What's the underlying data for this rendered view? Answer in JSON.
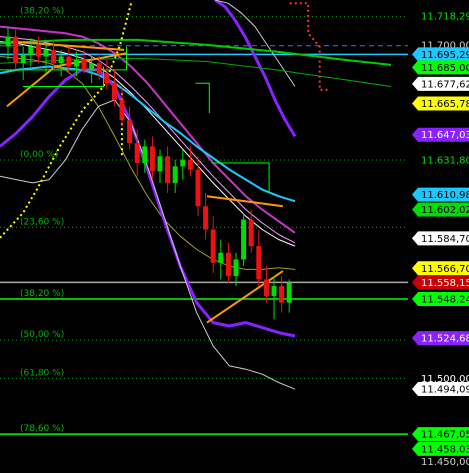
{
  "chart_data": {
    "type": "candlestick",
    "ylim": [
      11.446,
      11.728
    ],
    "grid": false,
    "fib_levels": [
      {
        "label": "(38,20 %)",
        "price": 11.718,
        "color": "#00a000",
        "style": "dotted"
      },
      {
        "label": "(0,00 %)",
        "price": 11.6318,
        "color": "#00a000",
        "style": "dotted"
      },
      {
        "label": "(23,60 %)",
        "price": 11.5913,
        "color": "#00a000",
        "style": "dotted"
      },
      {
        "label": "(38,20 %)",
        "price": 11.5482,
        "color": "#00ff00",
        "style": "solid"
      },
      {
        "label": "(50,00 %)",
        "price": 11.5235,
        "color": "#00a000",
        "style": "dotted"
      },
      {
        "label": "(61,80 %)",
        "price": 11.5005,
        "color": "#00a000",
        "style": "dotted"
      },
      {
        "label": "(78,60 %)",
        "price": 11.467,
        "color": "#00ff00",
        "style": "solid"
      }
    ],
    "horizontal_lines": [
      {
        "price": 11.6953,
        "color": "#1ec8ff",
        "style": "solid"
      },
      {
        "price": 11.7005,
        "color": "#4a6bff",
        "style": "dashed"
      },
      {
        "price": 11.5582,
        "color": "#aaaaaa",
        "style": "solid"
      }
    ],
    "price_labels": [
      {
        "text": "11.718,29",
        "price": 11.7183,
        "bg": "#000000",
        "fg": "#00e000"
      },
      {
        "text": "11.700,00",
        "price": 11.701,
        "bg": "#000000",
        "fg": "#cfcfcf"
      },
      {
        "text": "11.695,29",
        "price": 11.6953,
        "bg": "#1ec8ff",
        "fg": "#000000"
      },
      {
        "text": "11.685,00",
        "price": 11.6875,
        "bg": "#00ff00",
        "fg": "#000000"
      },
      {
        "text": "11.677,62",
        "price": 11.6776,
        "bg": "#ffffff",
        "fg": "#000000"
      },
      {
        "text": "11.665,78",
        "price": 11.6658,
        "bg": "#ffff00",
        "fg": "#000000"
      },
      {
        "text": "11.647,03",
        "price": 11.647,
        "bg": "#8a22ff",
        "fg": "#ffffff"
      },
      {
        "text": "11.631,80",
        "price": 11.6318,
        "bg": "#000000",
        "fg": "#00e000"
      },
      {
        "text": "11.610,98",
        "price": 11.611,
        "bg": "#1ec8ff",
        "fg": "#000000"
      },
      {
        "text": "11.602,02",
        "price": 11.602,
        "bg": "#00dd00",
        "fg": "#000000"
      },
      {
        "text": "11.584,70",
        "price": 11.5847,
        "bg": "#ffffff",
        "fg": "#000000"
      },
      {
        "text": "11.566,70",
        "price": 11.5667,
        "bg": "#ffff00",
        "fg": "#000000"
      },
      {
        "text": "11.558,15",
        "price": 11.5582,
        "bg": "#cc0000",
        "fg": "#ffffff"
      },
      {
        "text": "11.548,24",
        "price": 11.5482,
        "bg": "#00ff00",
        "fg": "#000000"
      },
      {
        "text": "11.524,68",
        "price": 11.5247,
        "bg": "#8a22ff",
        "fg": "#ffffff"
      },
      {
        "text": "11.500,00",
        "price": 11.5003,
        "bg": "#000000",
        "fg": "#ffffff"
      },
      {
        "text": "11.494,09",
        "price": 11.4941,
        "bg": "#ffffff",
        "fg": "#000000"
      },
      {
        "text": "11.467,05",
        "price": 11.467,
        "bg": "#00ff00",
        "fg": "#000000"
      },
      {
        "text": "11.458,03",
        "price": 11.4581,
        "bg": "#00ff00",
        "fg": "#000000"
      },
      {
        "text": "11.450,00",
        "price": 11.4505,
        "bg": "#000000",
        "fg": "#cfcfcf"
      }
    ],
    "candles": [
      [
        11.7,
        11.712,
        11.692,
        11.706
      ],
      [
        11.706,
        11.71,
        11.686,
        11.69
      ],
      [
        11.69,
        11.7,
        11.68,
        11.695
      ],
      [
        11.695,
        11.705,
        11.688,
        11.7
      ],
      [
        11.7,
        11.706,
        11.69,
        11.694
      ],
      [
        11.694,
        11.702,
        11.684,
        11.698
      ],
      [
        11.698,
        11.704,
        11.686,
        11.69
      ],
      [
        11.69,
        11.698,
        11.682,
        11.694
      ],
      [
        11.694,
        11.7,
        11.684,
        11.688
      ],
      [
        11.688,
        11.697,
        11.682,
        11.692
      ],
      [
        11.692,
        11.698,
        11.684,
        11.686
      ],
      [
        11.686,
        11.694,
        11.678,
        11.69
      ],
      [
        11.69,
        11.696,
        11.68,
        11.684
      ],
      [
        11.684,
        11.692,
        11.674,
        11.678
      ],
      [
        11.678,
        11.686,
        11.664,
        11.668
      ],
      [
        11.668,
        11.676,
        11.652,
        11.656
      ],
      [
        11.656,
        11.664,
        11.638,
        11.642
      ],
      [
        11.642,
        11.65,
        11.622,
        11.63
      ],
      [
        11.63,
        11.644,
        11.624,
        11.64
      ],
      [
        11.64,
        11.646,
        11.62,
        11.625
      ],
      [
        11.625,
        11.638,
        11.618,
        11.634
      ],
      [
        11.634,
        11.64,
        11.612,
        11.618
      ],
      [
        11.618,
        11.632,
        11.612,
        11.628
      ],
      [
        11.628,
        11.638,
        11.62,
        11.632
      ],
      [
        11.632,
        11.64,
        11.622,
        11.626
      ],
      [
        11.626,
        11.634,
        11.598,
        11.604
      ],
      [
        11.604,
        11.612,
        11.584,
        11.59
      ],
      [
        11.59,
        11.598,
        11.564,
        11.57
      ],
      [
        11.57,
        11.584,
        11.56,
        11.576
      ],
      [
        11.576,
        11.582,
        11.558,
        11.562
      ],
      [
        11.562,
        11.576,
        11.556,
        11.572
      ],
      [
        11.572,
        11.6,
        11.568,
        11.596
      ],
      [
        11.596,
        11.602,
        11.576,
        11.58
      ],
      [
        11.58,
        11.59,
        11.556,
        11.56
      ],
      [
        11.56,
        11.568,
        11.546,
        11.55
      ],
      [
        11.55,
        11.562,
        11.536,
        11.556
      ],
      [
        11.556,
        11.562,
        11.54,
        11.546
      ],
      [
        11.546,
        11.56,
        11.54,
        11.558
      ]
    ],
    "indicator_lines": [
      {
        "name": "",
        "color": "#cc33cc",
        "width": 2,
        "values": [
          11.712,
          11.711,
          11.71,
          11.709,
          11.708,
          11.706,
          11.702,
          11.696,
          11.688,
          11.678,
          11.666,
          11.654,
          11.642,
          11.63,
          11.62,
          11.61,
          11.602,
          11.595,
          11.588
        ]
      },
      {
        "name": "",
        "color": "#ff99ff",
        "width": 1,
        "values": [
          11.706,
          11.705,
          11.704,
          11.702,
          11.7,
          11.697,
          11.692,
          11.685,
          11.676,
          11.666,
          11.655,
          11.644,
          11.633,
          11.622,
          11.612,
          11.602,
          11.594,
          11.587,
          11.582
        ]
      },
      {
        "name": "",
        "color": "#ffffff",
        "width": 1,
        "values": [
          11.703,
          11.702,
          11.7,
          11.698,
          11.696,
          11.693,
          11.688,
          11.681,
          11.672,
          11.662,
          11.651,
          11.64,
          11.629,
          11.618,
          11.608,
          11.598,
          11.59,
          11.584,
          11.58
        ]
      },
      {
        "name": "",
        "color": "#1ec8ff",
        "width": 2,
        "values": [
          11.684,
          11.686,
          11.687,
          11.688,
          11.687,
          11.686,
          11.683,
          11.678,
          11.671,
          11.663,
          11.655,
          11.648,
          11.64,
          11.633,
          11.626,
          11.62,
          11.614,
          11.61,
          11.607
        ]
      },
      {
        "name": "",
        "color": "#a0a020",
        "width": 1,
        "values": [
          11.694,
          11.693,
          11.692,
          11.69,
          11.686,
          11.678,
          11.664,
          11.646,
          11.627,
          11.61,
          11.596,
          11.586,
          11.578,
          11.572,
          11.568,
          11.566,
          11.566,
          11.567,
          11.566
        ]
      },
      {
        "name": "",
        "color": "#8a22ff",
        "width": 3,
        "values": [
          11.64,
          11.648,
          11.658,
          11.67,
          11.68,
          11.686,
          11.686,
          11.676,
          11.654,
          11.626,
          11.596,
          11.568,
          11.546,
          11.534,
          11.532,
          11.534,
          11.531,
          11.528,
          11.526
        ]
      },
      {
        "name": "",
        "color": "#cccccc",
        "width": 1,
        "values": [
          11.622,
          11.62,
          11.618,
          11.62,
          11.632,
          11.65,
          11.664,
          11.668,
          11.654,
          11.628,
          11.598,
          11.568,
          11.54,
          11.52,
          11.508,
          11.506,
          11.503,
          11.498,
          11.494
        ]
      },
      {
        "name": "",
        "color": "#8a22ff",
        "width": 3,
        "values": [
          11.728,
          11.724,
          11.716,
          11.706,
          11.694,
          11.682,
          11.668,
          11.656,
          11.646
        ]
      },
      {
        "name": "",
        "color": "#cccccc",
        "width": 1,
        "values": [
          11.728,
          11.726,
          11.72,
          11.712,
          11.7,
          11.688,
          11.676
        ]
      }
    ],
    "overlay_lines": [
      {
        "name": "",
        "color": "#00cc00",
        "width": 2,
        "points": [
          [
            0,
            11.702
          ],
          [
            3,
            11.704
          ],
          [
            6,
            11.704
          ],
          [
            9,
            11.701
          ],
          [
            12,
            11.697
          ],
          [
            15,
            11.692
          ],
          [
            17,
            11.689
          ]
        ]
      },
      {
        "name": "",
        "color": "#00aa00",
        "width": 1,
        "points": [
          [
            0,
            11.69
          ],
          [
            3,
            11.692
          ],
          [
            6,
            11.693
          ],
          [
            9,
            11.691
          ],
          [
            12,
            11.686
          ],
          [
            15,
            11.68
          ],
          [
            17,
            11.676
          ]
        ]
      },
      {
        "name": "",
        "color": "#ff3333",
        "width": 2,
        "style": "dotted",
        "points": [
          [
            12.6,
            11.726
          ],
          [
            13.4,
            11.726
          ],
          [
            13.4,
            11.708
          ],
          [
            13.9,
            11.7
          ],
          [
            13.9,
            11.674
          ],
          [
            14.3,
            11.674
          ]
        ]
      },
      {
        "name": "",
        "color": "#ffff00",
        "width": 2,
        "style": "dotted",
        "points": [
          [
            0,
            11.585
          ],
          [
            1,
            11.6
          ],
          [
            1.6,
            11.614
          ],
          [
            2.6,
            11.64
          ],
          [
            3.6,
            11.662
          ],
          [
            4.5,
            11.676
          ],
          [
            5.2,
            11.7
          ],
          [
            5.7,
            11.726
          ]
        ]
      },
      {
        "name": "",
        "color": "#ffff00",
        "width": 2,
        "style": "dotted",
        "points": [
          [
            5.3,
            11.672
          ],
          [
            5.3,
            11.634
          ]
        ]
      },
      {
        "name": "",
        "color": "#ff9900",
        "width": 2,
        "points": [
          [
            0.5,
            11.703
          ],
          [
            5.4,
            11.698
          ]
        ]
      },
      {
        "name": "",
        "color": "#ff9900",
        "width": 2,
        "points": [
          [
            0.3,
            11.664
          ],
          [
            2.4,
            11.688
          ],
          [
            5.5,
            11.696
          ]
        ]
      },
      {
        "name": "",
        "color": "#ff9900",
        "width": 2,
        "points": [
          [
            9.0,
            11.61
          ],
          [
            12.3,
            11.604
          ]
        ]
      },
      {
        "name": "",
        "color": "#ff9900",
        "width": 2,
        "points": [
          [
            9.0,
            11.534
          ],
          [
            12.3,
            11.565
          ]
        ]
      },
      {
        "name": "",
        "color": "#00ff00",
        "width": 1,
        "points": [
          [
            0,
            11.686
          ],
          [
            5.5,
            11.686
          ],
          [
            5.5,
            11.7
          ]
        ]
      },
      {
        "name": "",
        "color": "#00ff00",
        "width": 1,
        "points": [
          [
            1.0,
            11.676
          ],
          [
            4.5,
            11.676
          ],
          [
            4.5,
            11.688
          ]
        ]
      },
      {
        "name": "",
        "color": "#00ff00",
        "width": 1,
        "points": [
          [
            8.5,
            11.678
          ],
          [
            9.1,
            11.678
          ],
          [
            9.1,
            11.66
          ]
        ]
      },
      {
        "name": "",
        "color": "#00ff00",
        "width": 1,
        "points": [
          [
            9.2,
            11.63
          ],
          [
            11.7,
            11.63
          ],
          [
            11.7,
            11.612
          ]
        ]
      }
    ]
  }
}
